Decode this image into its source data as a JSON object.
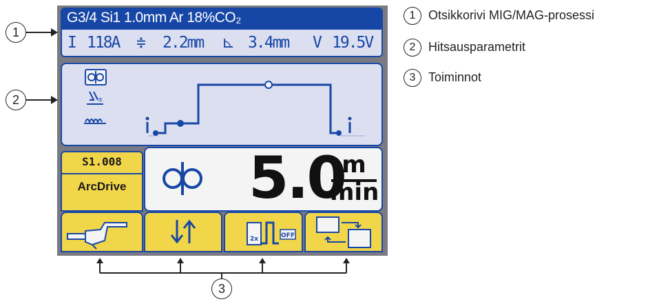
{
  "screen": {
    "title": "G3/4 Si1 1.0mm Ar 18%CO₂",
    "params": {
      "current_symbol": "I",
      "current_value": "118A",
      "wire_symbol": "≑",
      "wire_value": "2.2mm",
      "throat_symbol": "⊾",
      "throat_value": "3.4mm",
      "voltage_symbol": "V",
      "voltage_value": "19.5V"
    },
    "program_code": "S1.008",
    "mode_label": "ArcDrive",
    "wire_feed": {
      "value": "5.0",
      "unit_top": "m",
      "unit_bottom": "min"
    },
    "softkey_icons": [
      "torch-icon",
      "up-down-arrows-icon",
      "2x-trigger-off-icon",
      "parameter-swap-icon"
    ],
    "colors": {
      "accent": "#1747a6",
      "panel": "#dcdff0",
      "softkey": "#f2d64a"
    }
  },
  "legend": {
    "items": [
      {
        "number": "1",
        "text": "Otsikkorivi MIG/MAG-prosessi"
      },
      {
        "number": "2",
        "text": "Hitsausparametrit"
      },
      {
        "number": "3",
        "text": "Toiminnot"
      }
    ]
  },
  "callouts": {
    "one": "1",
    "two": "2",
    "three": "3"
  }
}
